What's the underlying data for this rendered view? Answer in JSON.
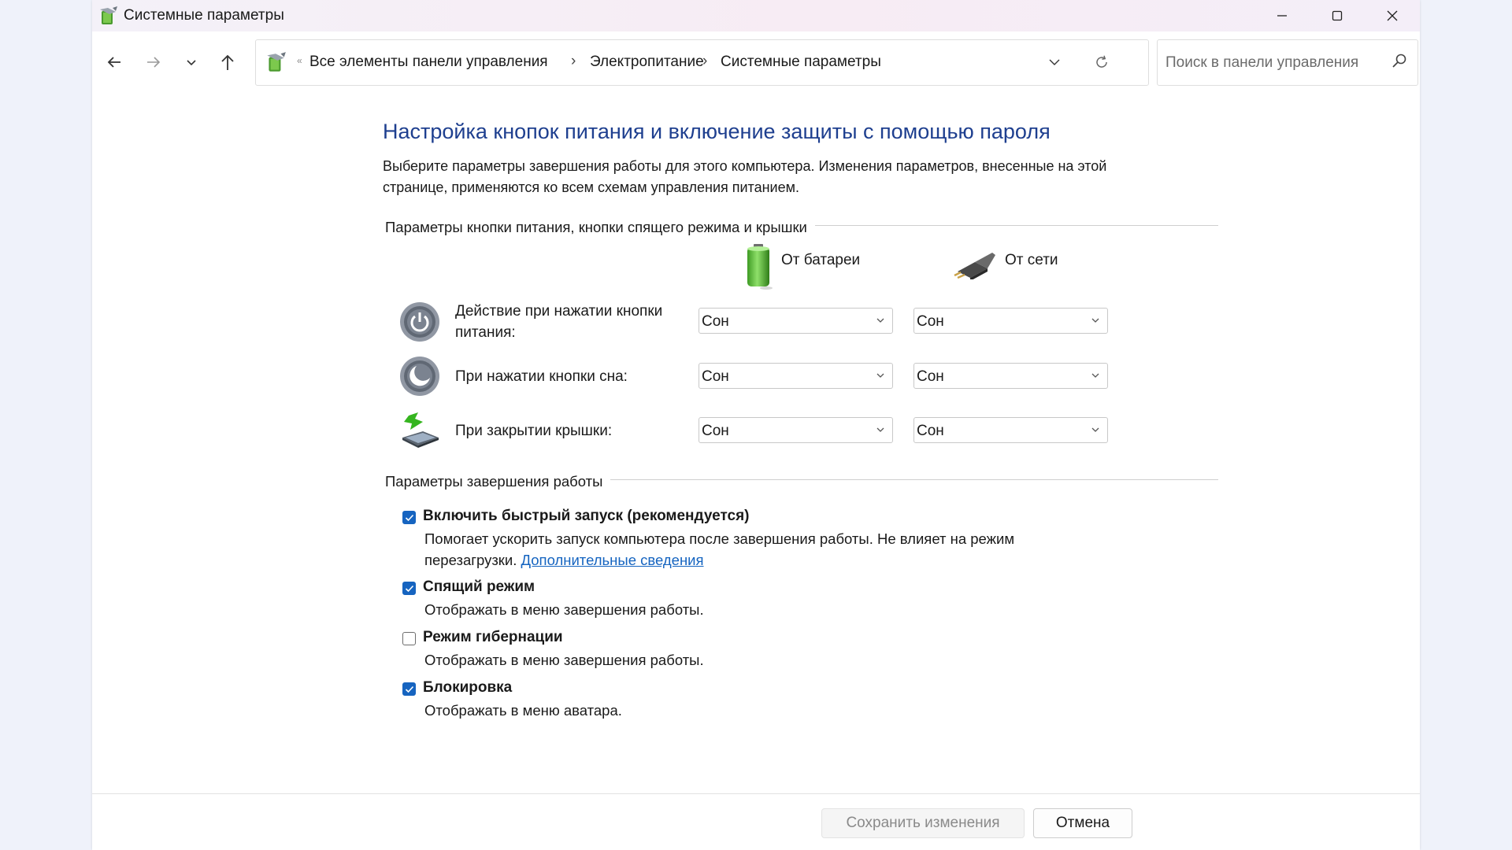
{
  "window": {
    "title": "Системные параметры",
    "controls": {
      "minimize": "minimize-icon",
      "maximize": "maximize-icon",
      "close": "close-icon"
    }
  },
  "nav": {
    "back": "arrow-left-icon",
    "forward": "arrow-right-icon",
    "recent": "chevron-down-icon",
    "up": "arrow-up-icon"
  },
  "address": {
    "overflow": "«",
    "crumbs": [
      "Все элементы панели управления",
      "Электропитание",
      "Системные параметры"
    ],
    "separator": "›"
  },
  "search": {
    "placeholder": "Поиск в панели управления",
    "value": ""
  },
  "page": {
    "title": "Настройка кнопок питания и включение защиты с помощью пароля",
    "intro": "Выберите параметры завершения работы для этого компьютера. Изменения параметров, внесенные на этой странице, применяются ко всем схемам управления питанием."
  },
  "power_section": {
    "heading": "Параметры кнопки питания, кнопки спящего режима и крышки",
    "columns": {
      "battery": "От батареи",
      "plugged": "От сети"
    },
    "rows": [
      {
        "label": "Действие при нажатии кнопки питания:",
        "battery": "Сон",
        "plugged": "Сон",
        "icon": "power-button-icon"
      },
      {
        "label": "При нажатии кнопки сна:",
        "battery": "Сон",
        "plugged": "Сон",
        "icon": "sleep-button-icon"
      },
      {
        "label": "При закрытии крышки:",
        "battery": "Сон",
        "plugged": "Сон",
        "icon": "laptop-lid-icon"
      }
    ]
  },
  "shutdown_section": {
    "heading": "Параметры завершения работы",
    "options": [
      {
        "label": "Включить быстрый запуск (рекомендуется)",
        "checked": true,
        "desc": "Помогает ускорить запуск компьютера после завершения работы. Не влияет на режим перезагрузки.",
        "link": "Дополнительные сведения"
      },
      {
        "label": "Спящий режим",
        "checked": true,
        "desc": "Отображать в меню завершения работы."
      },
      {
        "label": "Режим гибернации",
        "checked": false,
        "desc": "Отображать в меню завершения работы."
      },
      {
        "label": "Блокировка",
        "checked": true,
        "desc": "Отображать в меню аватара."
      }
    ]
  },
  "footer": {
    "save": "Сохранить изменения",
    "cancel": "Отмена"
  },
  "colors": {
    "title": "#1e3f8f",
    "accent": "#1664c0",
    "link": "#1564c0"
  }
}
